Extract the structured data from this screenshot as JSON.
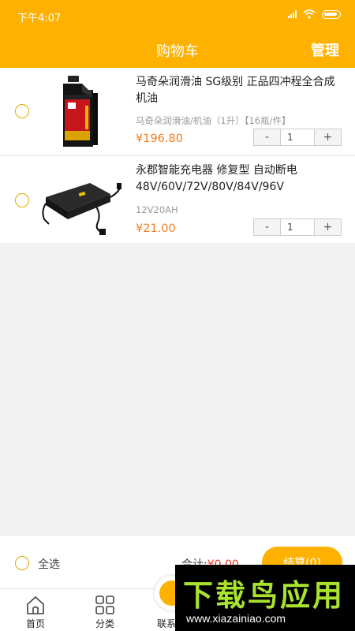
{
  "status_bar": {
    "time": "下午4:07"
  },
  "nav": {
    "title": "购物车",
    "manage_label": "管理"
  },
  "items": [
    {
      "title": "马奇朵润滑油  SG级别  正品四冲程全合成机油",
      "spec": "马奇朵润滑油/机油（1升）【16瓶/件】",
      "price": "¥196.80",
      "qty": "1",
      "minus": "-",
      "plus": "+"
    },
    {
      "title": "永郡智能充电器 修复型 自动断电 48V/60V/72V/80V/84V/96V",
      "spec": "12V20AH",
      "price": "¥21.00",
      "qty": "1",
      "minus": "-",
      "plus": "+"
    }
  ],
  "checkout": {
    "select_all_label": "全选",
    "total_label": "合计:",
    "total_amount": "¥0.00",
    "button_label": "结算(0)"
  },
  "tabs": [
    {
      "label": "首页",
      "icon": "home-icon"
    },
    {
      "label": "分类",
      "icon": "grid-icon"
    },
    {
      "label": "联系",
      "icon": "contact-icon"
    }
  ],
  "watermark": {
    "main": "下载鸟应用",
    "url": "www.xiazainiao.com"
  },
  "colors": {
    "accent": "#ffb100",
    "price": "#f47c20",
    "total": "#f0341a",
    "watermark_green": "#a9e22f"
  }
}
